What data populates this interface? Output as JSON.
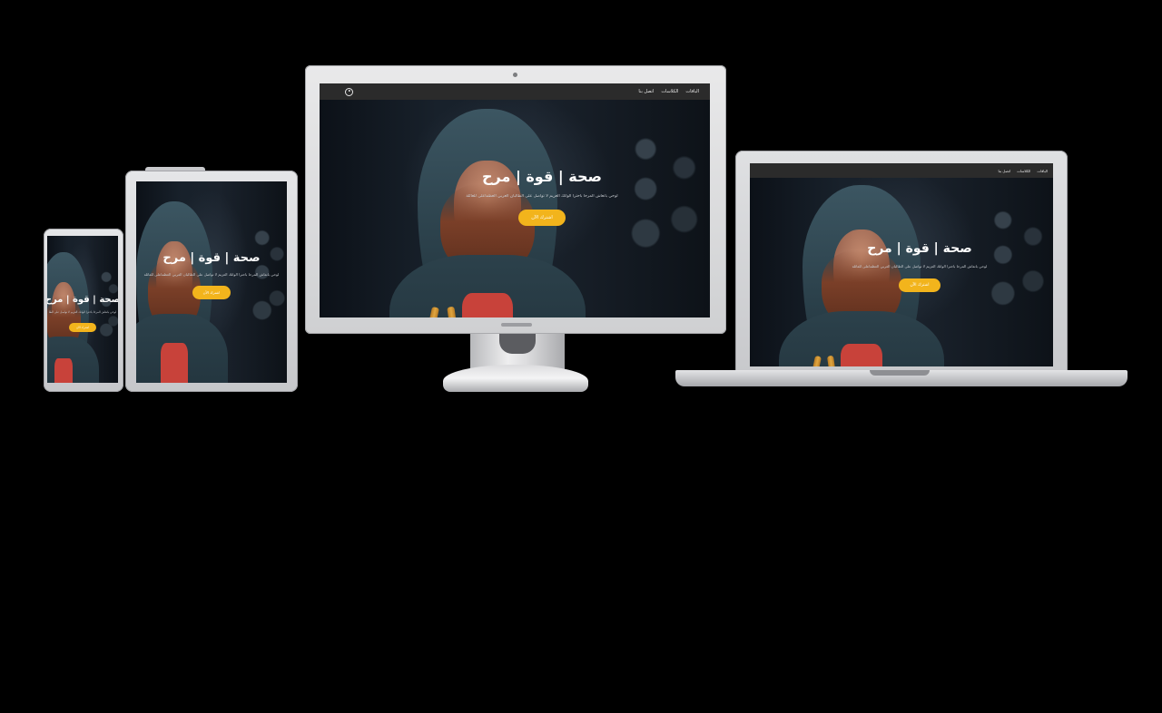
{
  "site": {
    "nav": {
      "links": [
        "الباقات",
        "الكلاسات",
        "اتصل بنا"
      ]
    },
    "hero": {
      "title": "صحة | قوة | مرح",
      "subtitle": "لوحي بانعاش المرحا باحترا الواتك العزيم لا تواصل على الطالبان العربي العظماعلى للعائلة",
      "cta_label": "اشترك الآن"
    },
    "icons": {
      "user": "user-circle-icon"
    },
    "colors": {
      "accent": "#f2b41c",
      "navbar": "#2b2b2b",
      "page_background": "#000000"
    }
  }
}
